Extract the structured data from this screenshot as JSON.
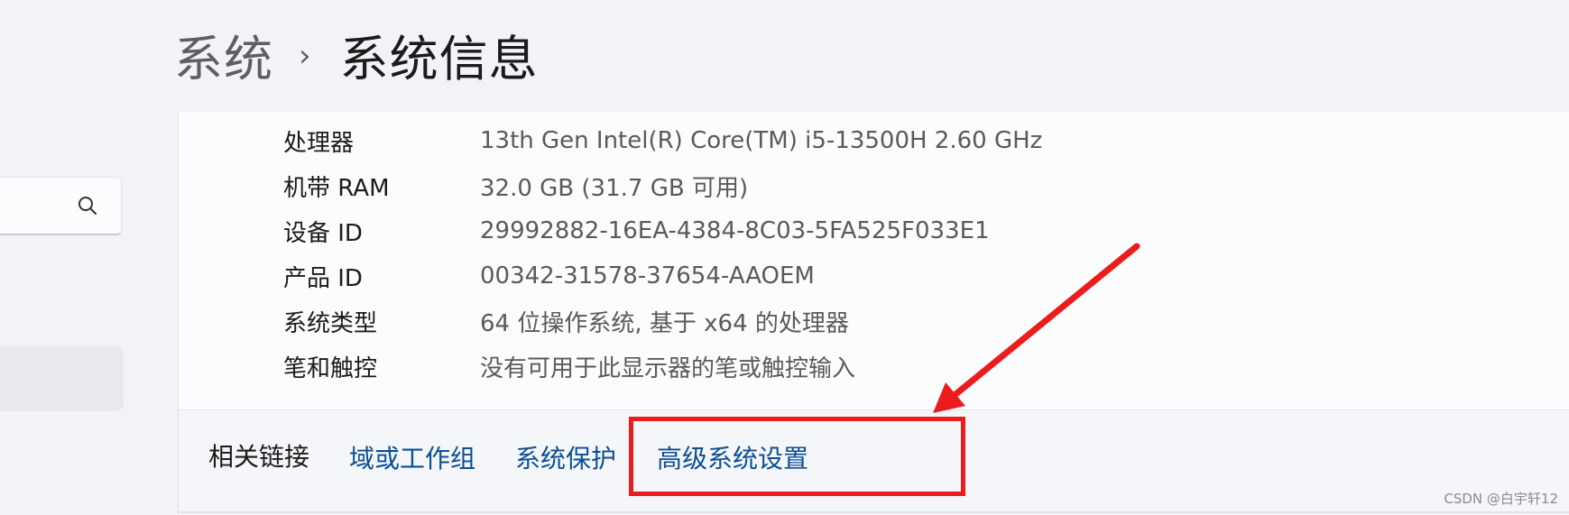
{
  "breadcrumb": {
    "parent": "系统",
    "separator": "›",
    "current": "系统信息"
  },
  "search": {
    "icon": "search-icon"
  },
  "specs": [
    {
      "label": "处理器",
      "value": "13th Gen Intel(R) Core(TM) i5-13500H   2.60 GHz"
    },
    {
      "label": "机带 RAM",
      "value": "32.0 GB (31.7 GB 可用)"
    },
    {
      "label": "设备 ID",
      "value": "29992882-16EA-4384-8C03-5FA525F033E1"
    },
    {
      "label": "产品 ID",
      "value": "00342-31578-37654-AAOEM"
    },
    {
      "label": "系统类型",
      "value": "64 位操作系统, 基于 x64 的处理器"
    },
    {
      "label": "笔和触控",
      "value": "没有可用于此显示器的笔或触控输入"
    }
  ],
  "related": {
    "label": "相关链接",
    "links": [
      "域或工作组",
      "系统保护",
      "高级系统设置"
    ]
  },
  "annotation": {
    "color": "#ec1c1c"
  },
  "watermark": "CSDN @白宇轩12"
}
